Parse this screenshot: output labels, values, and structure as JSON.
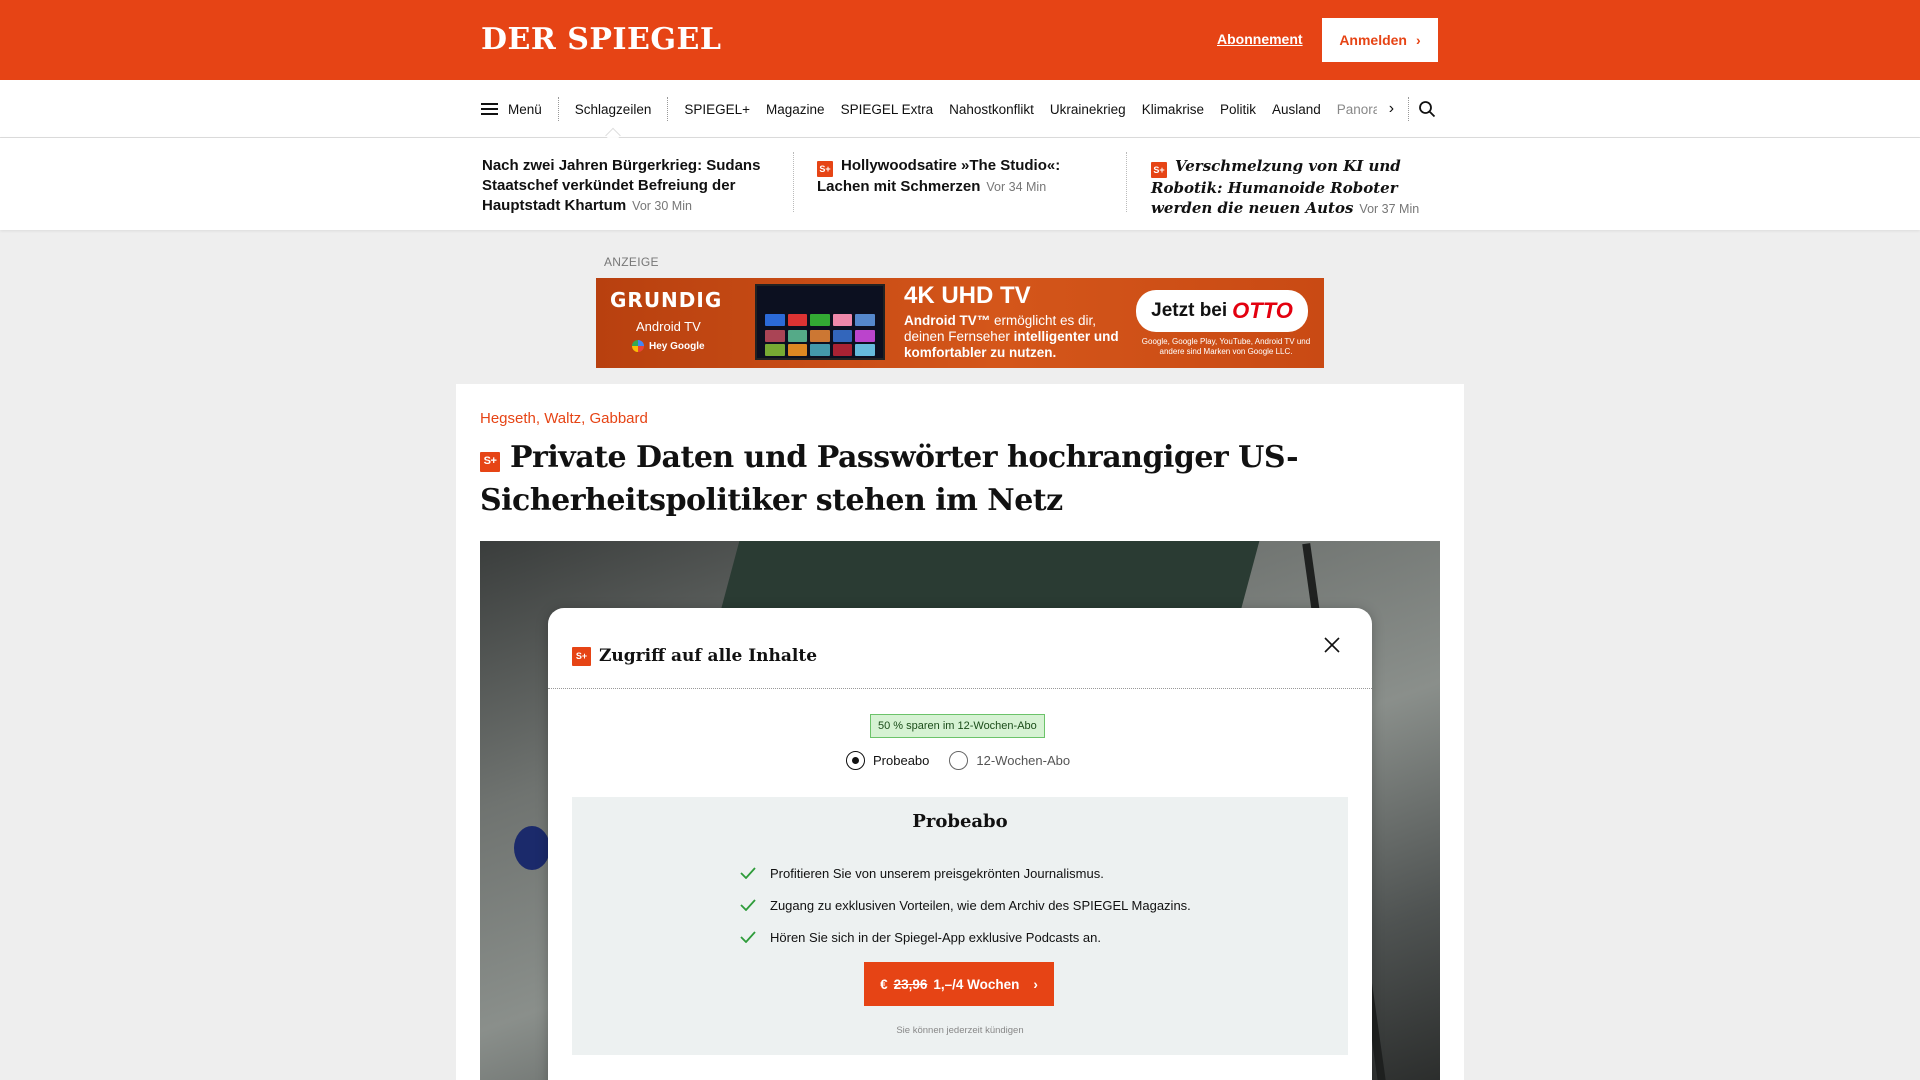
{
  "header": {
    "logo": "DER SPIEGEL",
    "subscription_link": "Abonnement",
    "login_button": "Anmelden",
    "brand_color": "#e64415"
  },
  "nav": {
    "menu_label": "Menü",
    "items": [
      "Schlagzeilen",
      "SPIEGEL+",
      "Magazine",
      "SPIEGEL Extra",
      "Nahostkonflikt",
      "Ukrainekrieg",
      "Klimakrise",
      "Politik",
      "Ausland"
    ],
    "overflow_item": "Panorama",
    "active": "Schlagzeilen"
  },
  "teasers": [
    {
      "title": "Nach zwei Jahren Bürgerkrieg: Sudans Staatschef verkündet Befreiung der Hauptstadt Khartum",
      "time": "Vor 30 Min",
      "plus": false
    },
    {
      "title": "Hollywoodsatire »The Studio«: Lachen mit Schmerzen",
      "time": "Vor 34 Min",
      "plus": true
    },
    {
      "title": "Verschmelzung von KI und Robotik: Humanoide Roboter werden die neuen Autos",
      "time": "Vor 37 Min",
      "plus": true
    }
  ],
  "ad": {
    "label": "ANZEIGE",
    "brand": "GRUNDIG",
    "platform": "Android TV",
    "assistant": "Hey Google",
    "title": "4K UHD TV",
    "text_bold1": "Android TV™",
    "text_regular1": " ermöglicht es dir, deinen Fernseher ",
    "text_bold2": "intelligenter und komfortabler zu nutzen.",
    "cta_prefix": "Jetzt bei",
    "cta_brand": "OTTO",
    "fineprint": "Google, Google Play, YouTube, Android TV und andere sind Marken von Google LLC."
  },
  "article": {
    "kicker": "Hegseth, Waltz, Gabbard",
    "plus_badge": "S+",
    "headline": "Private Daten und Passwörter hochrangiger US-Sicherheitspolitiker stehen im Netz"
  },
  "modal": {
    "title": "Zugriff auf alle Inhalte",
    "savings_badge": "50 % sparen im 12-Wochen-Abo",
    "options": [
      {
        "label": "Probeabo",
        "selected": true
      },
      {
        "label": "12-Wochen-Abo",
        "selected": false
      }
    ],
    "offer_title": "Probeabo",
    "features": [
      "Profitieren Sie von unserem preisgekrönten Journalismus.",
      "Zugang zu exklusiven Vorteilen, wie dem Archiv des SPIEGEL Magazins.",
      "Hören Sie sich in der Spiegel-App exklusive Podcasts an."
    ],
    "cta_currency": "€",
    "cta_old_price": "23,96",
    "cta_new_price": "1,–/4 Wochen",
    "cancel_note": "Sie können jederzeit kündigen"
  }
}
